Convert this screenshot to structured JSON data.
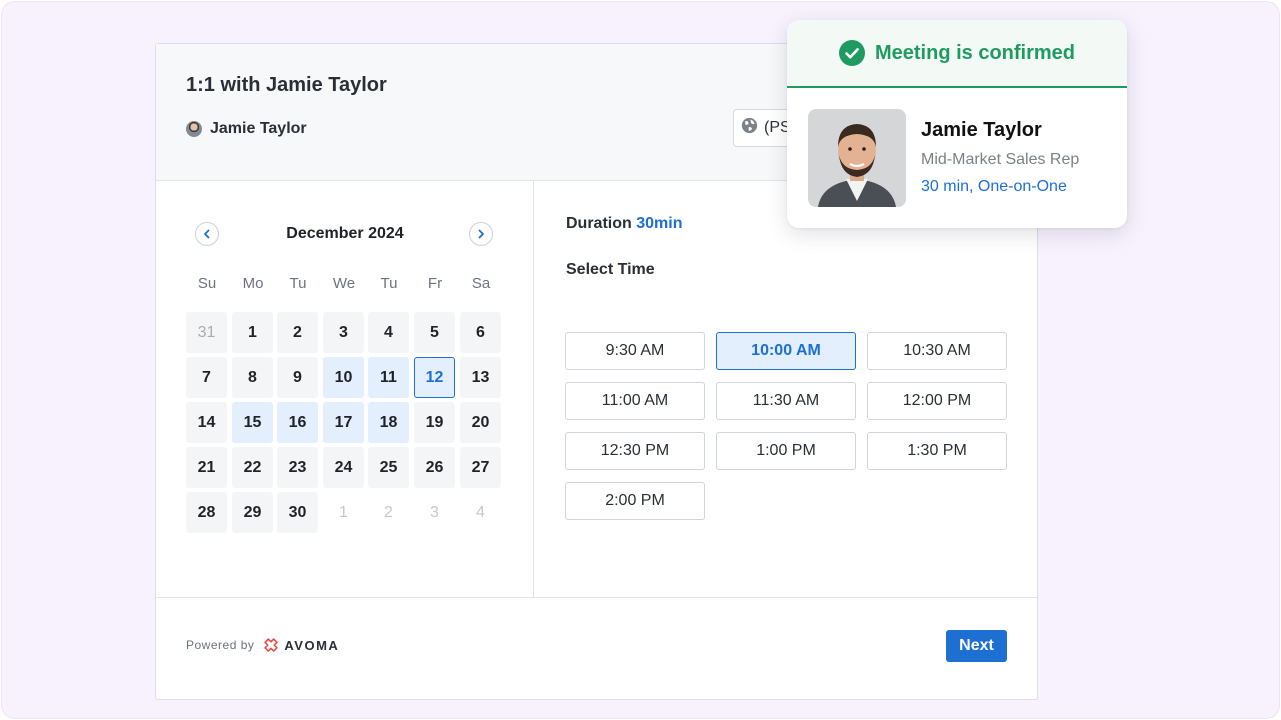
{
  "header": {
    "meeting_title": "1:1 with Jamie Taylor",
    "host_name": "Jamie Taylor",
    "timezone_text": "(PS"
  },
  "calendar": {
    "month_label": "December 2024",
    "weekdays": [
      "Su",
      "Mo",
      "Tu",
      "We",
      "Tu",
      "Fr",
      "Sa"
    ],
    "weeks": [
      [
        "31",
        "1",
        "2",
        "3",
        "4",
        "5",
        "6"
      ],
      [
        "7",
        "8",
        "9",
        "10",
        "11",
        "12",
        "13"
      ],
      [
        "14",
        "15",
        "16",
        "17",
        "18",
        "19",
        "20"
      ],
      [
        "21",
        "22",
        "23",
        "24",
        "25",
        "26",
        "27"
      ],
      [
        "28",
        "29",
        "30",
        "1",
        "2",
        "3",
        "4"
      ]
    ],
    "selected_day": "12",
    "available_days": [
      "10",
      "11",
      "12",
      "15",
      "16",
      "17",
      "18"
    ]
  },
  "scheduler": {
    "duration_label": "Duration",
    "duration_value": "30min",
    "select_time_label": "Select Time",
    "slots": [
      [
        "9:30 AM",
        "10:00 AM",
        "10:30 AM"
      ],
      [
        "11:00 AM",
        "11:30 AM",
        "12:00 PM"
      ],
      [
        "12:30 PM",
        "1:00 PM",
        "1:30 PM"
      ],
      [
        "2:00 PM"
      ]
    ],
    "selected_slot": "10:00 AM"
  },
  "footer": {
    "powered_by": "Powered by",
    "brand": "AVOMA",
    "next_label": "Next"
  },
  "confirmation": {
    "title": "Meeting is confirmed",
    "name": "Jamie Taylor",
    "role": "Mid-Market Sales Rep",
    "meta": "30 min, One-on-One"
  },
  "colors": {
    "accent": "#1d6fd1",
    "confirm_green": "#1f9a60",
    "brand_red": "#e8473b",
    "background": "#f7f2fd"
  },
  "icons": {
    "timezone": "globe-icon",
    "prev": "chevron-left-icon",
    "next": "chevron-right-icon",
    "confirmed": "check-circle-icon",
    "brand": "avoma-logo-icon"
  }
}
